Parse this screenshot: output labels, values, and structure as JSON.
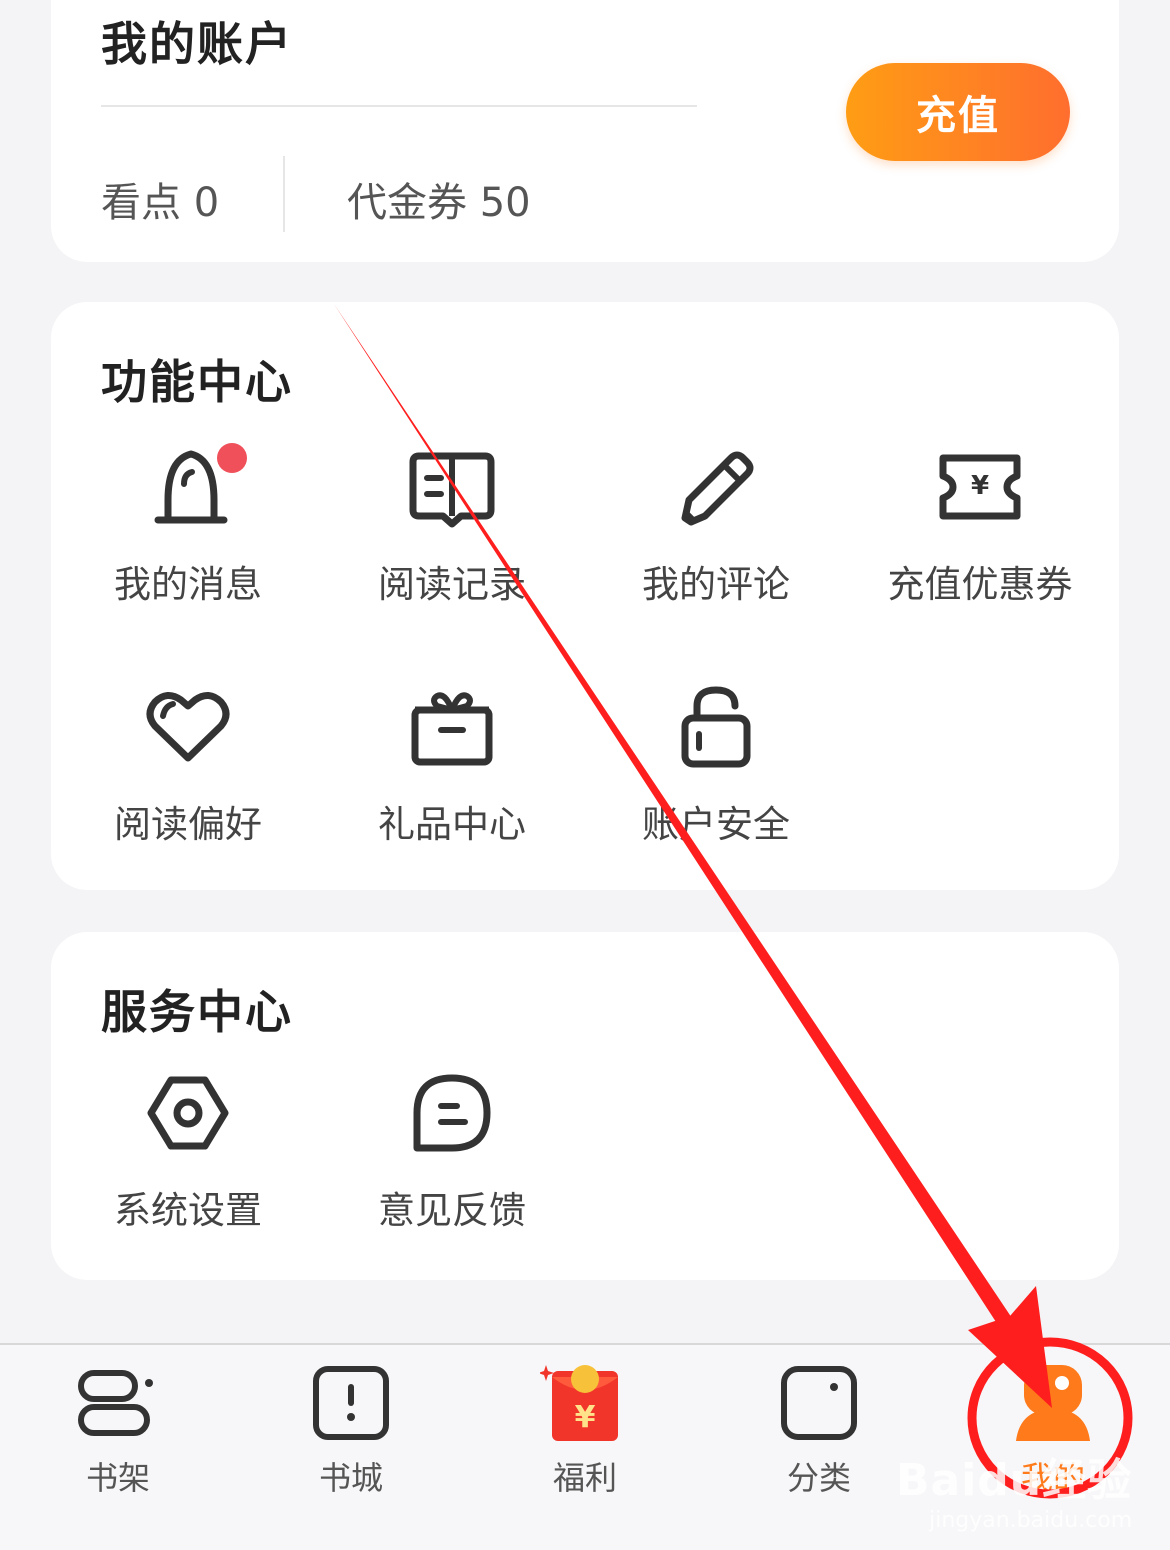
{
  "account": {
    "title": "我的账户",
    "kandian": "看点 0",
    "voucher": "代金券 50",
    "recharge_label": "充值"
  },
  "functions": {
    "title": "功能中心",
    "items": [
      {
        "label": "我的消息",
        "icon": "bell-icon"
      },
      {
        "label": "阅读记录",
        "icon": "reading-history-icon"
      },
      {
        "label": "我的评论",
        "icon": "pencil-icon"
      },
      {
        "label": "充值优惠券",
        "icon": "coupon-icon"
      },
      {
        "label": "阅读偏好",
        "icon": "heart-icon"
      },
      {
        "label": "礼品中心",
        "icon": "gift-icon"
      },
      {
        "label": "账户安全",
        "icon": "lock-icon"
      }
    ]
  },
  "services": {
    "title": "服务中心",
    "items": [
      {
        "label": "系统设置",
        "icon": "settings-icon"
      },
      {
        "label": "意见反馈",
        "icon": "feedback-icon"
      }
    ]
  },
  "nav": {
    "items": [
      {
        "label": "书架",
        "icon": "bookshelf-icon"
      },
      {
        "label": "书城",
        "icon": "bookstore-icon"
      },
      {
        "label": "福利",
        "icon": "red-envelope-icon"
      },
      {
        "label": "分类",
        "icon": "category-icon"
      },
      {
        "label": "我的",
        "icon": "profile-icon",
        "active": true
      }
    ]
  },
  "watermark": {
    "brand": "Baidu经验",
    "domain": "jingyan.baidu.com"
  },
  "colors": {
    "accent": "#ff7a1a",
    "badge": "#f0505a",
    "annotation": "#ff1e1e"
  }
}
